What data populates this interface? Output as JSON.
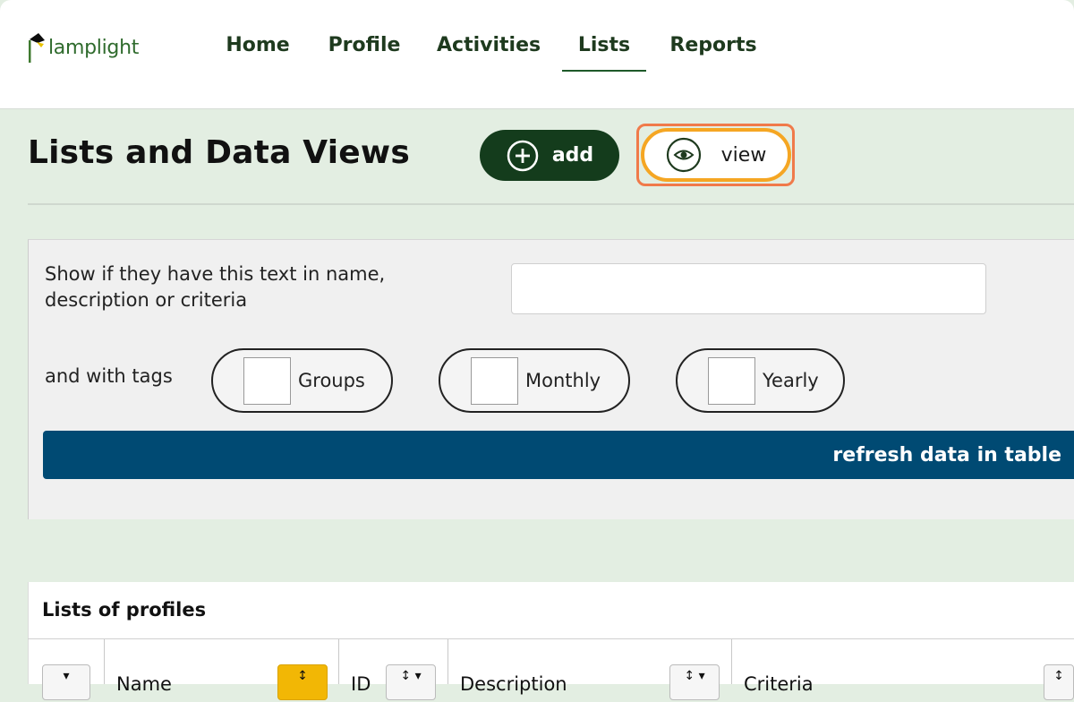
{
  "brand": {
    "name": "lamplight"
  },
  "nav": {
    "items": [
      {
        "label": "Home"
      },
      {
        "label": "Profile"
      },
      {
        "label": "Activities"
      },
      {
        "label": "Lists"
      },
      {
        "label": "Reports"
      }
    ],
    "active": "Lists"
  },
  "page": {
    "title": "Lists and Data Views",
    "add_label": "add",
    "view_label": "view"
  },
  "filters": {
    "text_label": "Show if they have this text in name, description or criteria",
    "text_value": "",
    "tags_label": "and with tags",
    "tags": [
      {
        "label": "Groups",
        "checked": false
      },
      {
        "label": "Monthly",
        "checked": false
      },
      {
        "label": "Yearly",
        "checked": false
      }
    ],
    "refresh_label": "refresh data in table"
  },
  "table": {
    "title": "Lists of profiles",
    "columns": [
      {
        "label": ""
      },
      {
        "label": "Name"
      },
      {
        "label": "ID"
      },
      {
        "label": "Description"
      },
      {
        "label": "Criteria"
      }
    ]
  },
  "colors": {
    "nav_text": "#1e3a1e",
    "add_button": "#143c1c",
    "view_focus": "#f5a623",
    "refresh_button": "#004a73",
    "page_bg": "#e3eee2"
  }
}
